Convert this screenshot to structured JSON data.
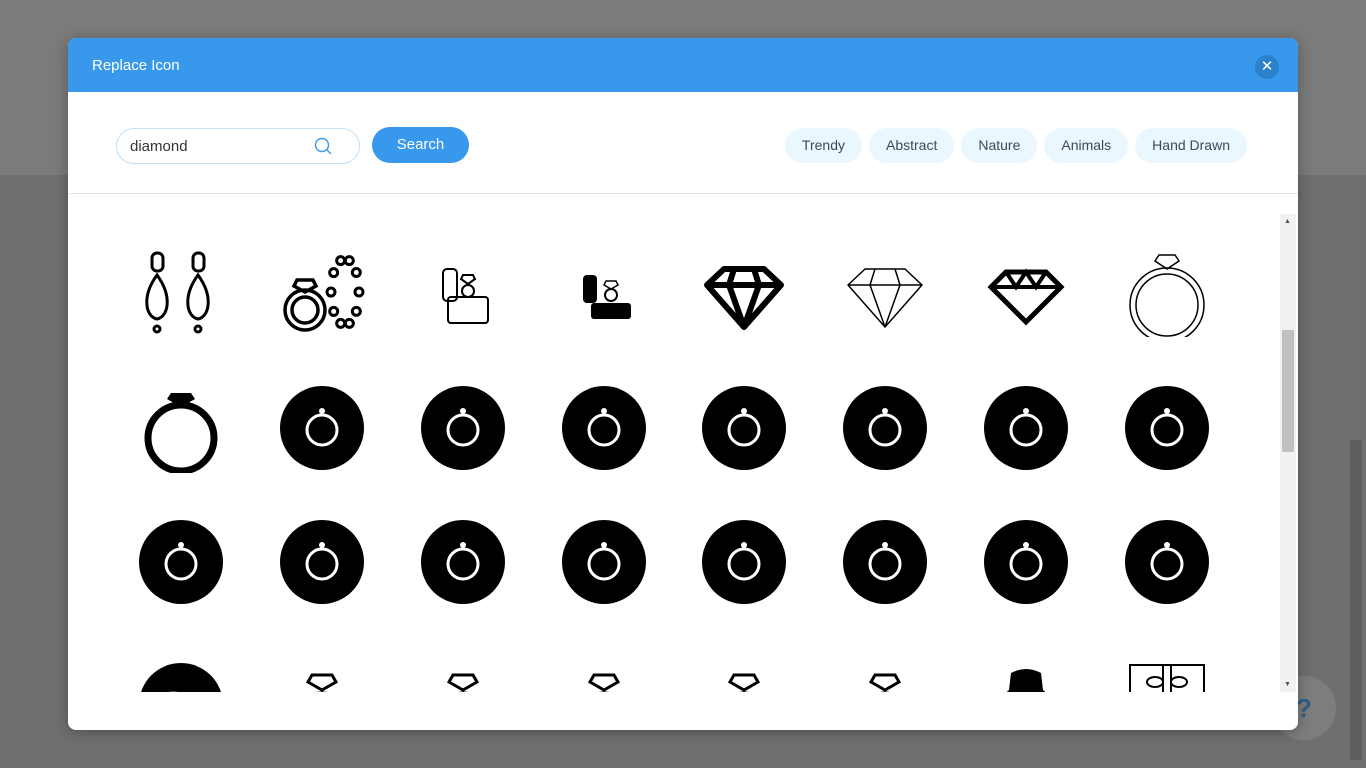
{
  "dialog": {
    "title": "Replace Icon",
    "close_icon": "close-icon"
  },
  "search": {
    "value": "diamond",
    "button": "Search",
    "icon": "search-icon"
  },
  "categories": [
    "Trendy",
    "Abstract",
    "Nature",
    "Animals",
    "Hand Drawn"
  ],
  "help": {
    "label": "?"
  },
  "accent": "#3899ec",
  "icons": [
    [
      "drop-earrings-icon",
      "ring-and-pearl-necklace-icon",
      "ring-box-outline-icon",
      "ring-box-filled-icon",
      "diamond-bold-icon",
      "diamond-thin-icon",
      "diamond-icon",
      "diamond-ring-outline-icon"
    ],
    [
      "diamond-ring-bold-icon",
      "ring-circle-icon",
      "heart-necklace-circle-icon",
      "gem-necklace-circle-icon",
      "ring-circle-bold-icon",
      "pearl-necklace-circle-icon",
      "tiara-circle-icon",
      "earrings-circle-icon"
    ],
    [
      "bracelet-circle-icon",
      "necklace-circle-icon",
      "crown-circle-icon",
      "watch-circle-icon",
      "bust-necklace-circle-icon",
      "ring-box-circle-icon",
      "gem-bracelet-circle-icon",
      "collar-necklace-circle-icon"
    ],
    [
      "jewel-circle-icon",
      "diamond-ring-icon",
      "wedding-rings-icon",
      "ring-icon",
      "double-diamond-rings-icon",
      "sparkling-rings-icon",
      "necklace-bust-icon",
      "gift-box-icon"
    ]
  ]
}
